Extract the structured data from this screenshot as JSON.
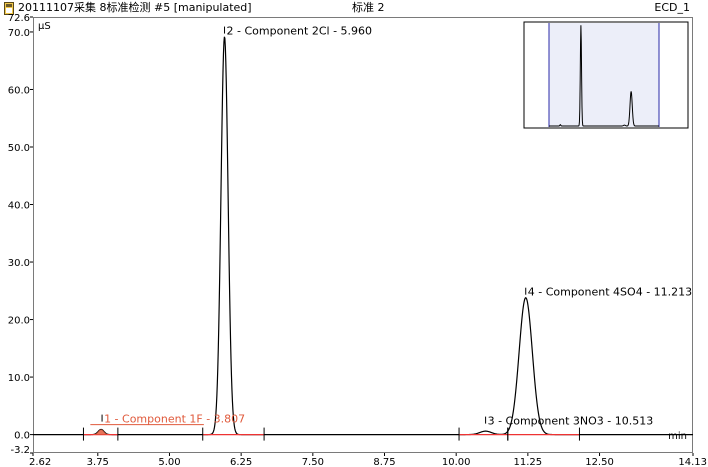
{
  "window": {
    "sample_title": "20111107采集 8标准检测 #5 [manipulated]",
    "center_title": "标准 2",
    "detector": "ECD_1"
  },
  "chart_data": {
    "type": "line",
    "ylabel": "µS",
    "xlabel": "min",
    "xlim": [
      2.62,
      14.13
    ],
    "ylim": [
      -3.2,
      72.6
    ],
    "x_ticks": [
      "2.62",
      "3.75",
      "5.00",
      "6.25",
      "7.50",
      "8.75",
      "10.00",
      "11.25",
      "12.50",
      "14.13"
    ],
    "y_ticks": [
      "72.6",
      "70.0",
      "60.0",
      "50.0",
      "40.0",
      "30.0",
      "20.0",
      "10.0",
      "0.0",
      "-3.2"
    ],
    "baseline": 0.0,
    "peaks": [
      {
        "number": "1",
        "name": "Component 1F",
        "rt": 3.807,
        "height": 0.9,
        "width": 0.05,
        "label": "1 - Component 1F - 3.807",
        "color": "#e05a3c",
        "start": 3.5,
        "end": 4.1
      },
      {
        "number": "2",
        "name": "Component 2Cl",
        "rt": 5.96,
        "height": 69.2,
        "width": 0.062,
        "label": "2 - Component 2Cl - 5.960",
        "color": "#000000",
        "start": 5.58,
        "end": 6.65
      },
      {
        "number": "3",
        "name": "Component 3NO3",
        "rt": 10.513,
        "height": 0.6,
        "width": 0.1,
        "label": "3 - Component 3NO3 - 10.513",
        "color": "#000000",
        "start": 10.05,
        "end": 10.9
      },
      {
        "number": "4",
        "name": "Component 4SO4",
        "rt": 11.213,
        "height": 23.8,
        "width": 0.115,
        "label": "4 - Component 4SO4 - 11.213",
        "color": "#000000",
        "start": 10.9,
        "end": 12.15
      }
    ],
    "inset": {
      "description": "overview chromatogram",
      "window_markers": true
    },
    "grid": false,
    "legend": "none"
  }
}
